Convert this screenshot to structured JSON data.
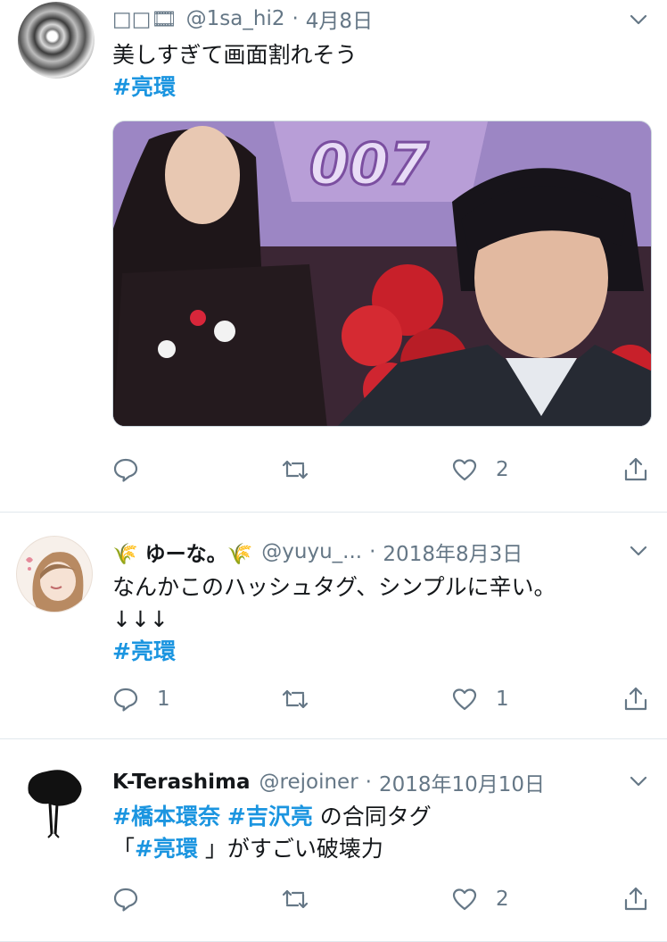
{
  "tweets": [
    {
      "name": "□□🎞",
      "handle": "@1sa_hi2",
      "dot": "·",
      "date": "4月8日",
      "lines": [
        "美しすぎて画面割れそう"
      ],
      "hashtag_line": "#亮環",
      "replies": "",
      "retweets": "",
      "likes": "2"
    },
    {
      "name": "🌾 ゆーな。🌾",
      "handle": "@yuyu_...",
      "dot": "·",
      "date": "2018年8月3日",
      "lines": [
        "なんかこのハッシュタグ、シンプルに辛い。",
        "↓↓↓"
      ],
      "hashtag_line": "#亮環",
      "replies": "1",
      "retweets": "",
      "likes": "1"
    },
    {
      "name": "K-Terashima",
      "handle": "@rejoiner",
      "dot": "·",
      "date": "2018年10月10日",
      "line1_tag1": "#橋本環奈",
      "line1_tag2": "#吉沢亮",
      "line1_rest": " の合同タグ",
      "line2_open": "「",
      "line2_tag": "#亮環",
      "line2_rest": " 」がすごい破壊力",
      "replies": "",
      "retweets": "",
      "likes": "2"
    }
  ],
  "icons": {
    "reply": "reply-icon",
    "retweet": "retweet-icon",
    "like": "heart-icon",
    "share": "share-icon",
    "menu": "chevron-down-icon"
  },
  "colors": {
    "hashtag": "#1b95e0",
    "muted": "#657786",
    "divider": "#e1e8ed"
  }
}
